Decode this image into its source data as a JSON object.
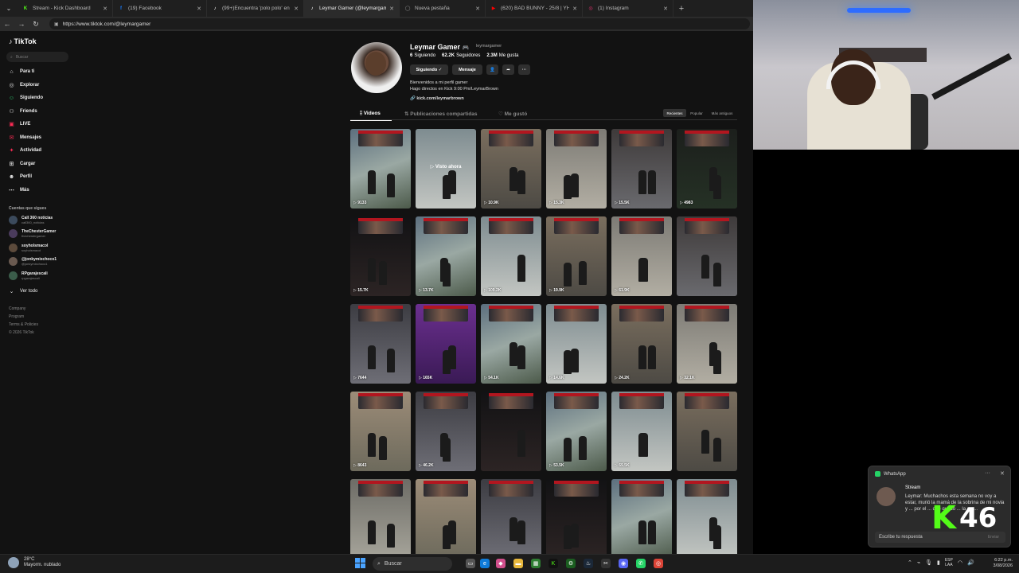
{
  "browser": {
    "tabs": [
      {
        "label": "Stream - Kick Dashboard",
        "icon": "kick-icon",
        "color": "#53fc18",
        "active": false
      },
      {
        "label": "(19) Facebook",
        "icon": "facebook-icon",
        "color": "#1877f2",
        "active": false
      },
      {
        "label": "(99+)Encuentra 'polo polo' en TikTok",
        "icon": "tiktok-icon",
        "color": "#ffffff",
        "active": false
      },
      {
        "label": "Leymar Gamer (@leymargamer)",
        "icon": "tiktok-icon",
        "color": "#ffffff",
        "active": true
      },
      {
        "label": "Nueva pestaña",
        "icon": "new-tab-icon",
        "color": "#888888",
        "active": false
      },
      {
        "label": "(620) BAD BUNNY - 25/8 | YHLQMDLG",
        "icon": "youtube-icon",
        "color": "#ff0000",
        "active": false
      },
      {
        "label": "(1) Instagram",
        "icon": "instagram-icon",
        "color": "#e1306c",
        "active": false
      }
    ],
    "url": "https://www.tiktok.com/@leymargamer"
  },
  "sidebar": {
    "logo": "TikTok",
    "search_placeholder": "Buscar",
    "nav": [
      {
        "label": "Para ti",
        "icon": "home-icon"
      },
      {
        "label": "Explorar",
        "icon": "compass-icon"
      },
      {
        "label": "Siguiendo",
        "icon": "following-icon"
      },
      {
        "label": "Friends",
        "icon": "friends-icon"
      },
      {
        "label": "LIVE",
        "icon": "live-icon"
      },
      {
        "label": "Mensajes",
        "icon": "messages-icon"
      },
      {
        "label": "Actividad",
        "icon": "activity-icon"
      },
      {
        "label": "Cargar",
        "icon": "upload-icon"
      },
      {
        "label": "Perfil",
        "icon": "profile-icon"
      },
      {
        "label": "Más",
        "icon": "more-icon"
      }
    ],
    "following_heading": "Cuentas que sigues",
    "accounts": [
      {
        "name": "Call 360 noticias",
        "handle": "call360_noticias"
      },
      {
        "name": "TheChesterGamer",
        "handle": "thechestergamer"
      },
      {
        "name": "soyholsmacol",
        "handle": "soyholsmacol"
      },
      {
        "name": "@jonkymixchoco1",
        "handle": "@jonkymixchoco1"
      },
      {
        "name": "RPgarajescali",
        "handle": "rpgarajescali"
      }
    ],
    "see_all": "Ver todo",
    "footer": [
      "Company",
      "Program",
      "Terms & Policies",
      "© 2026 TikTok"
    ]
  },
  "profile": {
    "name": "Leymar Gamer",
    "handle": "leymargamer",
    "following_count": "6",
    "following_label": "Siguiendo",
    "followers_count": "62.2K",
    "followers_label": "Seguidores",
    "likes_count": "2.3M",
    "likes_label": "Me gusta",
    "btn_following": "Siguiendo ✓",
    "btn_message": "Mensaje",
    "bio_line1": "Bienvenidos a mi perfil gamer",
    "bio_line2": "Hago directos en Kick 9:00 Pm/LeymarBrown",
    "link": "kick.com/leymarbrown"
  },
  "tabs": {
    "videos": "Videos",
    "reposts": "Publicaciones compartidas",
    "liked": "Me gustó",
    "sort_recent": "Recientes",
    "sort_popular": "Popular",
    "sort_oldest": "Más antiguos"
  },
  "videos": [
    {
      "views": "9133",
      "overlay": ""
    },
    {
      "views": "",
      "overlay": "▷ Visto ahora"
    },
    {
      "views": "10.9K",
      "overlay": ""
    },
    {
      "views": "15.3K",
      "overlay": ""
    },
    {
      "views": "15.5K",
      "overlay": ""
    },
    {
      "views": "4983",
      "overlay": ""
    },
    {
      "views": "15.7K",
      "overlay": ""
    },
    {
      "views": "13.7K",
      "overlay": ""
    },
    {
      "views": "109.2K",
      "overlay": ""
    },
    {
      "views": "19.9K",
      "overlay": ""
    },
    {
      "views": "61.9K",
      "overlay": ""
    },
    {
      "views": "",
      "overlay": ""
    },
    {
      "views": "7644",
      "overlay": ""
    },
    {
      "views": "165K",
      "overlay": ""
    },
    {
      "views": "54.1K",
      "overlay": ""
    },
    {
      "views": "14.6K",
      "overlay": ""
    },
    {
      "views": "24.2K",
      "overlay": ""
    },
    {
      "views": "32.1K",
      "overlay": ""
    },
    {
      "views": "8643",
      "overlay": ""
    },
    {
      "views": "46.2K",
      "overlay": ""
    },
    {
      "views": "",
      "overlay": ""
    },
    {
      "views": "53.5K",
      "overlay": ""
    },
    {
      "views": "69.5K",
      "overlay": ""
    },
    {
      "views": "",
      "overlay": ""
    },
    {
      "views": "",
      "overlay": ""
    },
    {
      "views": "",
      "overlay": ""
    },
    {
      "views": "",
      "overlay": ""
    },
    {
      "views": "",
      "overlay": ""
    },
    {
      "views": "",
      "overlay": ""
    },
    {
      "views": "",
      "overlay": ""
    }
  ],
  "notification": {
    "app": "WhatsApp",
    "title": "Stream",
    "message": "Leymar: Muchachos esta semana no voy a estar, murió la mamá de la sobrina de mi novia y ... por el ... qué quedó ... la ma...",
    "reply_placeholder": "Escribe tu respuesta",
    "send": "Enviar"
  },
  "overlay_counter": {
    "letter": "K",
    "value": "46",
    "color": "#53fc18"
  },
  "taskbar": {
    "temperature": "28°C",
    "weather": "Mayorm. nublado",
    "search": "Buscar",
    "lang1": "ESP",
    "lang2": "LAA",
    "time": "6:22 p.m.",
    "date": "3/08/2026"
  }
}
